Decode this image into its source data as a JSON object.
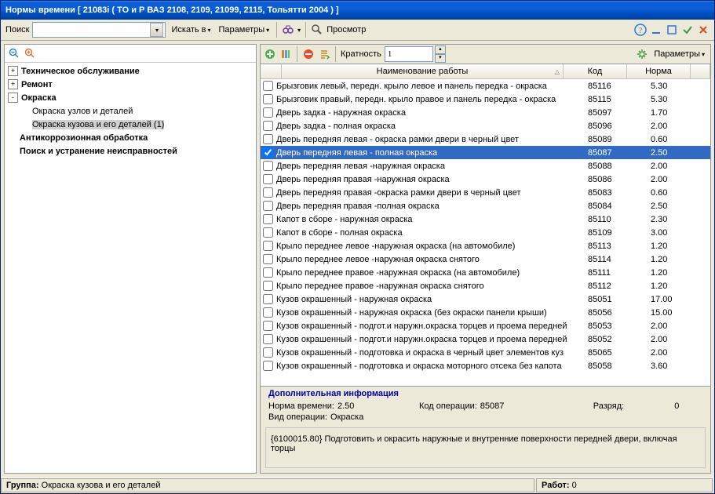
{
  "title": "Нормы времени [  21083i ( ТО и Р ВАЗ 2108, 2109, 21099, 2115, Тольятти 2004 )  ]",
  "toolbar": {
    "search_label": "Поиск",
    "search_value": "",
    "search_in": "Искать в",
    "params": "Параметры",
    "view": "Просмотр"
  },
  "tree": [
    {
      "exp": "+",
      "bold": true,
      "label": "Техническое обслуживание",
      "indent": 0
    },
    {
      "exp": "+",
      "bold": true,
      "label": "Ремонт",
      "indent": 0
    },
    {
      "exp": "-",
      "bold": true,
      "label": "Окраска",
      "indent": 0
    },
    {
      "exp": "",
      "bold": false,
      "label": "Окраска узлов и деталей",
      "indent": 1
    },
    {
      "exp": "",
      "bold": false,
      "label": "Окраска кузова и его деталей (1)",
      "indent": 1,
      "sel": true
    },
    {
      "exp": "",
      "bold": true,
      "label": "Антикоррозионная обработка",
      "indent": 0
    },
    {
      "exp": "",
      "bold": true,
      "label": "Поиск и устранение неисправностей",
      "indent": 0
    }
  ],
  "grid": {
    "multiplicity_label": "Кратность",
    "multiplicity_value": "1",
    "params_label": "Параметры",
    "headers": {
      "name": "Наименование работы",
      "code": "Код",
      "norm": "Норма"
    },
    "rows": [
      {
        "c": false,
        "n": "Брызговик левый, передн. крыло левое и панель передка - окраска",
        "k": "85116",
        "v": "5.30"
      },
      {
        "c": false,
        "n": "Брызговик правый, передн. крыло правое и панель передка - окраска",
        "k": "85115",
        "v": "5.30"
      },
      {
        "c": false,
        "n": "Дверь задка - наружная окраска",
        "k": "85097",
        "v": "1.70"
      },
      {
        "c": false,
        "n": "Дверь задка - полная окраска",
        "k": "85096",
        "v": "2.00"
      },
      {
        "c": false,
        "n": "Дверь передняя левая - окраска рамки двери в черный цвет",
        "k": "85089",
        "v": "0.60"
      },
      {
        "c": true,
        "n": "Дверь передняя левая - полная окраска",
        "k": "85087",
        "v": "2.50",
        "sel": true
      },
      {
        "c": false,
        "n": "Дверь передняя левая -наружная окраска",
        "k": "85088",
        "v": "2.00"
      },
      {
        "c": false,
        "n": "Дверь передняя правая -наружная окраска",
        "k": "85086",
        "v": "2.00"
      },
      {
        "c": false,
        "n": "Дверь передняя правая -окраска рамки двери в черный цвет",
        "k": "85083",
        "v": "0.60"
      },
      {
        "c": false,
        "n": "Дверь передняя правая -полная окраска",
        "k": "85084",
        "v": "2.50"
      },
      {
        "c": false,
        "n": "Капот в сборе - наружная окраска",
        "k": "85110",
        "v": "2.30"
      },
      {
        "c": false,
        "n": "Капот в сборе - полная окраска",
        "k": "85109",
        "v": "3.00"
      },
      {
        "c": false,
        "n": "Крыло переднее левое -наружная окраска (на автомобиле)",
        "k": "85113",
        "v": "1.20"
      },
      {
        "c": false,
        "n": "Крыло переднее левое -наружная окраска снятого",
        "k": "85114",
        "v": "1.20"
      },
      {
        "c": false,
        "n": "Крыло переднее правое -наружная окраска (на автомобиле)",
        "k": "85111",
        "v": "1.20"
      },
      {
        "c": false,
        "n": "Крыло переднее правое -наружная окраска снятого",
        "k": "85112",
        "v": "1.20"
      },
      {
        "c": false,
        "n": "Кузов окрашенный - наружная окраска",
        "k": "85051",
        "v": "17.00"
      },
      {
        "c": false,
        "n": "Кузов окрашенный - наружная окраска (без окраски панели крыши)",
        "k": "85056",
        "v": "15.00"
      },
      {
        "c": false,
        "n": "Кузов окрашенный - подгот.и наружн.окраска торцев и проема передней",
        "k": "85053",
        "v": "2.00"
      },
      {
        "c": false,
        "n": "Кузов окрашенный - подгот.и наружн.окраска торцев и проема передней",
        "k": "85052",
        "v": "2.00"
      },
      {
        "c": false,
        "n": "Кузов окрашенный - подготовка и окраска в черный цвет элементов куз",
        "k": "85065",
        "v": "2.00"
      },
      {
        "c": false,
        "n": "Кузов окрашенный - подготовка и окраска моторного отсека без капота",
        "k": "85058",
        "v": "3.60"
      }
    ]
  },
  "info": {
    "heading": "Дополнительная информация",
    "norm_label": "Норма времени:",
    "norm_value": "2.50",
    "opcode_label": "Код операции:",
    "opcode_value": "85087",
    "rank_label": "Разряд:",
    "rank_value": "0",
    "optype_label": "Вид операции:",
    "optype_value": "Окраска",
    "desc": "{6100015.80}  Подготовить и окрасить наружные и внутренние поверхности передней двери, включая торцы"
  },
  "status": {
    "group_label": "Группа:",
    "group_value": "Окраска кузова и его деталей",
    "works_label": "Работ:",
    "works_value": "0"
  }
}
